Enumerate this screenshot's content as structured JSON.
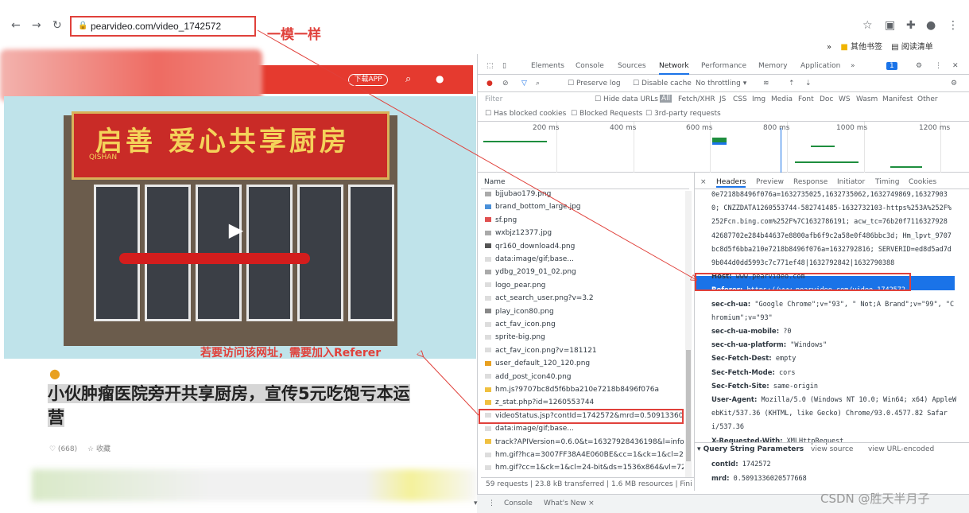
{
  "browser": {
    "url": "pearvideo.com/video_1742572",
    "annotation_same": "一模一样",
    "bookmark_other": "其他书签",
    "bookmark_reading": "阅读清单",
    "more": "»"
  },
  "page": {
    "download_app": "下载APP",
    "sign_text": "启善 爱心共享厨房",
    "sign_sub": "QISHAN",
    "referer_note": "若要访问该网址，需要加入Referer",
    "title": "小伙肿瘤医院旁开共享厨房，宣传5元吃饱亏本运营",
    "likes": "♡ (668)",
    "favorite": "☆ 收藏"
  },
  "devtools": {
    "tabs": [
      "Elements",
      "Console",
      "Sources",
      "Network",
      "Performance",
      "Memory",
      "Application",
      "»"
    ],
    "issues_count": "1",
    "preserve_log": "Preserve log",
    "disable_cache": "Disable cache",
    "throttling": "No throttling",
    "filter_placeholder": "Filter",
    "hide_data_urls": "Hide data URLs",
    "all": "All",
    "filter_types": [
      "Fetch/XHR",
      "JS",
      "CSS",
      "Img",
      "Media",
      "Font",
      "Doc",
      "WS",
      "Wasm",
      "Manifest",
      "Other"
    ],
    "has_blocked_cookies": "Has blocked cookies",
    "blocked_requests": "Blocked Requests",
    "third_party": "3rd-party requests",
    "ticks": [
      "200 ms",
      "400 ms",
      "600 ms",
      "800 ms",
      "1000 ms",
      "1200 ms"
    ],
    "name_header": "Name",
    "requests": [
      {
        "name": "bjjubao179.png",
        "color": "#aaaaaa"
      },
      {
        "name": "brand_bottom_large.jpg",
        "color": "#4a90d9"
      },
      {
        "name": "sf.png",
        "color": "#e05050"
      },
      {
        "name": "wxbjz12377.jpg",
        "color": "#aaaaaa"
      },
      {
        "name": "qr160_download4.png",
        "color": "#555555"
      },
      {
        "name": "data:image/gif;base...",
        "color": "#dddddd"
      },
      {
        "name": "ydbg_2019_01_02.png",
        "color": "#aaaaaa"
      },
      {
        "name": "logo_pear.png",
        "color": "#dddddd"
      },
      {
        "name": "act_search_user.png?v=3.2",
        "color": "#dddddd"
      },
      {
        "name": "play_icon80.png",
        "color": "#888888"
      },
      {
        "name": "act_fav_icon.png",
        "color": "#dddddd"
      },
      {
        "name": "sprite-big.png",
        "color": "#dddddd"
      },
      {
        "name": "act_fav_icon.png?v=181121",
        "color": "#dddddd"
      },
      {
        "name": "user_default_120_120.png",
        "color": "#e8a020"
      },
      {
        "name": "add_post_icon40.png",
        "color": "#dddddd"
      },
      {
        "name": "hm.js?9707bc8d5f6bba210e7218b8496f076a",
        "color": "#f0c040"
      },
      {
        "name": "z_stat.php?id=1260553744",
        "color": "#f0c040"
      },
      {
        "name": "videoStatus.jsp?contId=1742572&mrd=0.509133602057",
        "color": "#dddddd"
      },
      {
        "name": "data:image/gif;base...",
        "color": "#dddddd"
      },
      {
        "name": "track?APIVersion=0.6.0&t=16327928436198&l=info&lv=",
        "color": "#f0c040"
      },
      {
        "name": "hm.gif?hca=3007FF38A4E060BE&cc=1&ck=1&cl=24-bit",
        "color": "#dddddd"
      },
      {
        "name": "hm.gif?cc=1&ck=1&cl=24-bit&ds=1536x864&vl=722&e",
        "color": "#dddddd"
      }
    ],
    "status": "59 requests  |  23.8 kB transferred  |  1.6 MB resources  |  Fini",
    "detail_tabs": [
      "×",
      "Headers",
      "Preview",
      "Response",
      "Initiator",
      "Timing",
      "Cookies"
    ],
    "header_lines": [
      {
        "k": "",
        "v": "0e7218b8496f076a=1632735025,1632735062,1632749869,16327903"
      },
      {
        "k": "",
        "v": "0; CNZZDATA1260553744-582741485-1632732103-https%253A%252F%"
      },
      {
        "k": "",
        "v": "252Fcn.bing.com%252F%7C1632786191; acw_tc=76b20f7116327928"
      },
      {
        "k": "",
        "v": "42687702e284b44637e8800afb6f9c2a58e0f486bbc3d; Hm_lpvt_9707"
      },
      {
        "k": "",
        "v": "bc8d5f6bba210e7218b8496f076a=1632792816; SERVERID=ed8d5ad7d"
      },
      {
        "k": "",
        "v": "9b044d0dd5993c7c771ef48|1632792842|1632790388"
      },
      {
        "k": "Host:",
        "v": "www.pearvideo.com"
      },
      {
        "k": "Referer:",
        "v": "https://www.pearvideo.com/video_1742572"
      },
      {
        "k": "sec-ch-ua:",
        "v": "\"Google Chrome\";v=\"93\", \" Not;A Brand\";v=\"99\", \"C"
      },
      {
        "k": "",
        "v": "hromium\";v=\"93\""
      },
      {
        "k": "sec-ch-ua-mobile:",
        "v": "?0"
      },
      {
        "k": "sec-ch-ua-platform:",
        "v": "\"Windows\""
      },
      {
        "k": "Sec-Fetch-Dest:",
        "v": "empty"
      },
      {
        "k": "Sec-Fetch-Mode:",
        "v": "cors"
      },
      {
        "k": "Sec-Fetch-Site:",
        "v": "same-origin"
      },
      {
        "k": "User-Agent:",
        "v": "Mozilla/5.0 (Windows NT 10.0; Win64; x64) AppleW"
      },
      {
        "k": "",
        "v": "ebKit/537.36 (KHTML, like Gecko) Chrome/93.0.4577.82 Safar"
      },
      {
        "k": "",
        "v": "i/537.36"
      },
      {
        "k": "X-Requested-With:",
        "v": "XMLHttpRequest"
      }
    ],
    "qsp_title": "▾ Query String Parameters",
    "view_source": "view source",
    "view_url_encoded": "view URL-encoded",
    "params": [
      {
        "k": "contId:",
        "v": "1742572"
      },
      {
        "k": "mrd:",
        "v": "0.5091336020577668"
      }
    ],
    "console_tab": "Console",
    "whats_new": "What's New ×"
  },
  "watermark": "CSDN @胜天半月子"
}
